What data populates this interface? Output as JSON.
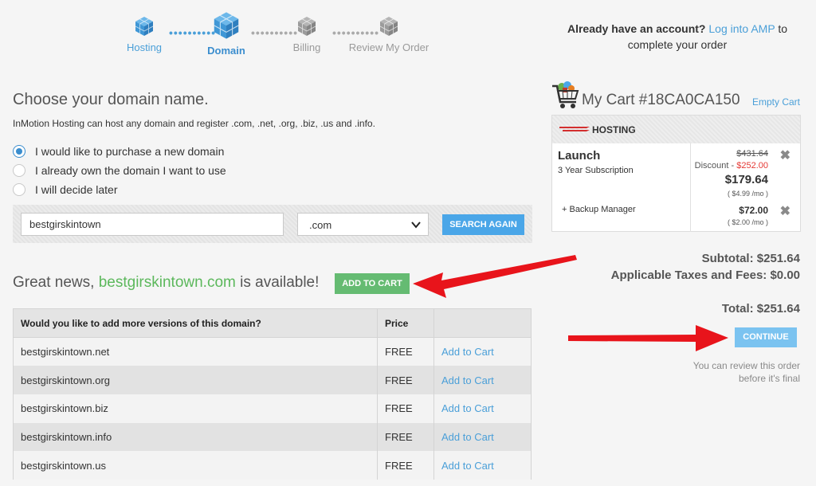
{
  "steps": [
    {
      "label": "Hosting",
      "state": "done"
    },
    {
      "label": "Domain",
      "state": "active"
    },
    {
      "label": "Billing",
      "state": "pending"
    },
    {
      "label": "Review My Order",
      "state": "pending"
    }
  ],
  "account": {
    "prefix": "Already have an account?",
    "link": "Log into AMP",
    "suffix_line1": "to",
    "line2": "complete your order"
  },
  "domain_section": {
    "title": "Choose your domain name.",
    "intro": "InMotion Hosting can host any domain and register .com, .net, .org, .biz, .us and .info.",
    "options": [
      {
        "label": "I would like to purchase a new domain",
        "checked": true
      },
      {
        "label": "I already own the domain I want to use",
        "checked": false
      },
      {
        "label": "I will decide later",
        "checked": false
      }
    ],
    "search_value": "bestgirskintown",
    "tld_selected": ".com",
    "search_button": "SEARCH AGAIN"
  },
  "availability": {
    "prefix": "Great news,",
    "domain": "bestgirskintown.com",
    "suffix": "is available!",
    "add_button": "ADD TO CART"
  },
  "versions_table": {
    "headers": [
      "Would you like to add more versions of this domain?",
      "Price",
      ""
    ],
    "rows": [
      {
        "domain": "bestgirskintown.net",
        "price": "FREE",
        "action": "Add to Cart"
      },
      {
        "domain": "bestgirskintown.org",
        "price": "FREE",
        "action": "Add to Cart"
      },
      {
        "domain": "bestgirskintown.biz",
        "price": "FREE",
        "action": "Add to Cart"
      },
      {
        "domain": "bestgirskintown.info",
        "price": "FREE",
        "action": "Add to Cart"
      },
      {
        "domain": "bestgirskintown.us",
        "price": "FREE",
        "action": "Add to Cart"
      }
    ]
  },
  "cart": {
    "title": "My Cart",
    "cart_id": "#18CA0CA150",
    "empty_label": "Empty Cart",
    "section": "HOSTING",
    "plan": {
      "name": "Launch",
      "term": "3 Year Subscription",
      "old_price": "$431.64",
      "discount_label": "Discount -",
      "discount_value": "$252.00",
      "price": "$179.64",
      "per_month": "( $4.99 /mo )"
    },
    "addon": {
      "name": "+ Backup Manager",
      "price": "$72.00",
      "per_month": "( $2.00 /mo )"
    },
    "subtotal": "Subtotal: $251.64",
    "taxes": "Applicable Taxes and Fees: $0.00",
    "total": "Total: $251.64",
    "continue_button": "CONTINUE",
    "review_note": "You can review this order before it's final"
  },
  "colors": {
    "accent_blue": "#4aa6e8",
    "success_green": "#65bb72",
    "annotation_red": "#e8141b"
  }
}
